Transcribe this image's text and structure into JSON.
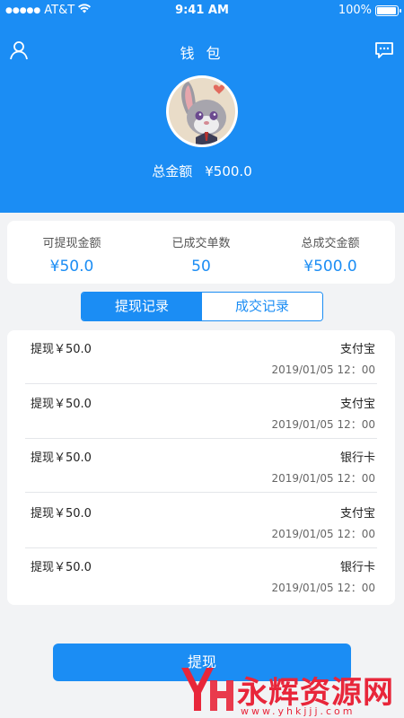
{
  "status_bar": {
    "carrier": "AT&T",
    "time": "9:41 AM",
    "battery": "100%",
    "battery_level": 1.0
  },
  "header": {
    "title": "钱 包",
    "total_label": "总金额",
    "total_value": "¥500.0"
  },
  "stats": [
    {
      "label": "可提现金额",
      "value": "¥50.0"
    },
    {
      "label": "已成交单数",
      "value": "50"
    },
    {
      "label": "总成交金额",
      "value": "¥500.0"
    }
  ],
  "tabs": [
    {
      "label": "提现记录",
      "active": true
    },
    {
      "label": "成交记录",
      "active": false
    }
  ],
  "records": [
    {
      "amount": "提现￥50.0",
      "method": "支付宝",
      "time": "2019/01/05 12：00"
    },
    {
      "amount": "提现￥50.0",
      "method": "支付宝",
      "time": "2019/01/05 12：00"
    },
    {
      "amount": "提现￥50.0",
      "method": "银行卡",
      "time": "2019/01/05 12：00"
    },
    {
      "amount": "提现￥50.0",
      "method": "支付宝",
      "time": "2019/01/05 12：00"
    },
    {
      "amount": "提现￥50.0",
      "method": "银行卡",
      "time": "2019/01/05 12：00"
    }
  ],
  "withdraw_button": "提现",
  "watermark": {
    "text": "永辉资源网",
    "url": "www.yhkjjj.com"
  },
  "icons": {
    "user": "user-icon",
    "message": "message-icon",
    "wifi": "wifi-icon"
  },
  "colors": {
    "primary": "#1b8df4",
    "background": "#f2f3f5",
    "watermark": "#e8263a"
  }
}
